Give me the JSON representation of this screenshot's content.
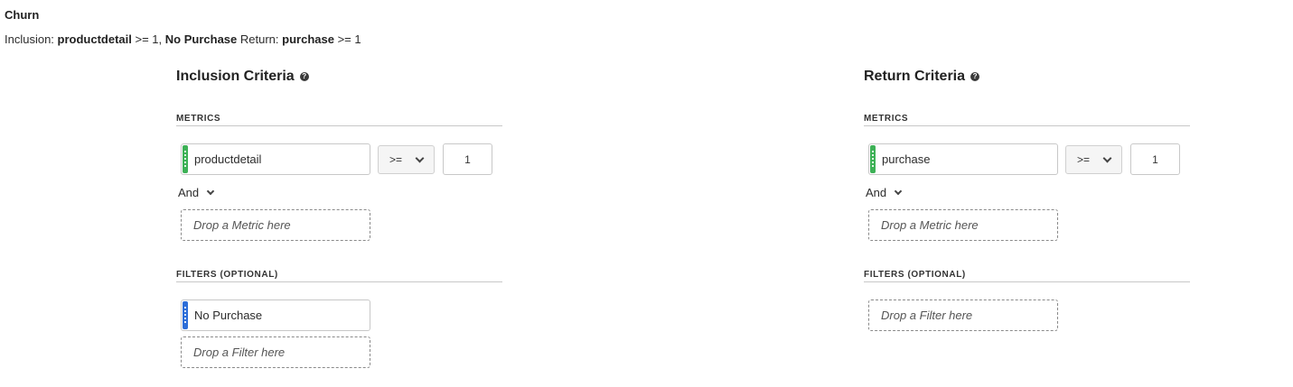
{
  "header": {
    "title": "Churn",
    "summary": {
      "inclusion_prefix": "Inclusion:",
      "inclusion_metric": "productdetail",
      "inclusion_condition": ">= 1,",
      "inclusion_filter": "No Purchase",
      "return_prefix": "Return:",
      "return_metric": "purchase",
      "return_condition": ">= 1"
    }
  },
  "inclusion": {
    "title": "Inclusion Criteria",
    "help_glyph": "?",
    "metrics_label": "METRICS",
    "metric": {
      "name": "productdetail",
      "operator": ">=",
      "value": "1",
      "handle_color": "#3db156"
    },
    "logic": "And",
    "metric_drop": "Drop a Metric here",
    "filters_label": "FILTERS (OPTIONAL)",
    "filter": {
      "name": "No Purchase",
      "handle_color": "#2d6ed8"
    },
    "filter_drop": "Drop a Filter here"
  },
  "return": {
    "title": "Return Criteria",
    "help_glyph": "?",
    "metrics_label": "METRICS",
    "metric": {
      "name": "purchase",
      "operator": ">=",
      "value": "1",
      "handle_color": "#3db156"
    },
    "logic": "And",
    "metric_drop": "Drop a Metric here",
    "filters_label": "FILTERS (OPTIONAL)",
    "filter_drop": "Drop a Filter here"
  }
}
